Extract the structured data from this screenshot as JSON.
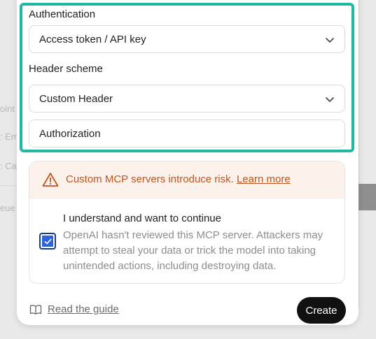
{
  "background": {
    "fragments": [
      "oint",
      ": Em",
      ": Ca",
      "eue"
    ]
  },
  "auth": {
    "label": "Authentication",
    "value": "Access token / API key"
  },
  "header_scheme": {
    "label": "Header scheme",
    "value": "Custom Header",
    "header_name_value": "Authorization"
  },
  "warning": {
    "message": "Custom MCP servers introduce risk.",
    "link": "Learn more",
    "checkbox_title": "I understand and want to continue",
    "checkbox_description": "OpenAI hasn't reviewed this MCP server. Attackers may attempt to steal your data or trick the model into taking unintended actions, including destroying data.",
    "checked": true
  },
  "footer": {
    "guide_label": "Read the guide",
    "create_label": "Create"
  },
  "colors": {
    "highlight": "#1fb8a4",
    "warning_text": "#c0551d",
    "warning_bg": "#fdf1ec",
    "checkbox": "#2a64d6",
    "primary_button": "#111111"
  },
  "icons": {
    "chevron": "chevron-down-icon",
    "warning": "warning-triangle-icon",
    "check": "check-icon",
    "book": "book-icon"
  }
}
